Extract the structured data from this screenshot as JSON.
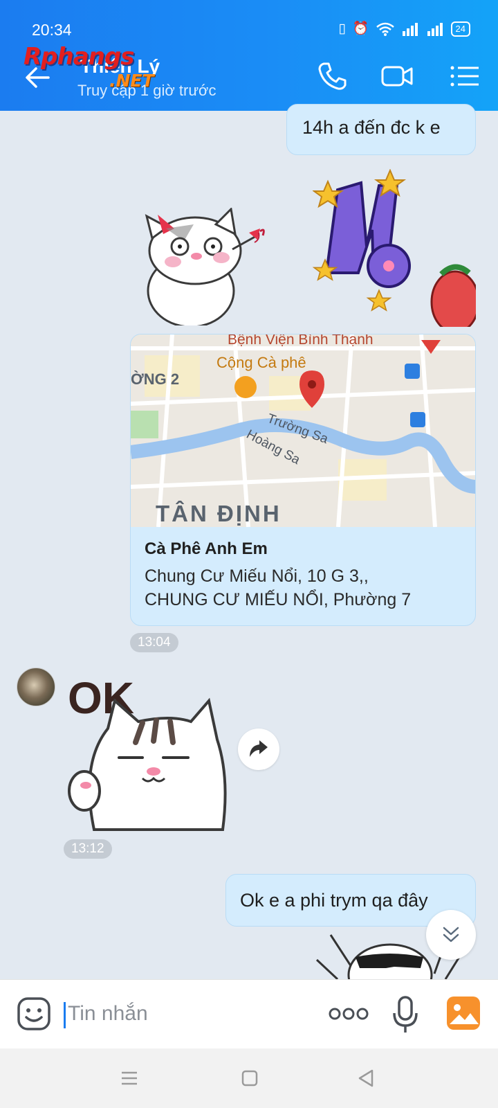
{
  "status_bar": {
    "time": "20:34",
    "battery": "24",
    "icons": [
      "vibrate-icon",
      "alarm-icon",
      "wifi-icon",
      "signal-icon",
      "signal-icon"
    ]
  },
  "header": {
    "contact_name": "Thiên Lý",
    "presence": "Truy cập 1 giờ trước",
    "watermark_main": "Rphangs",
    "watermark_suffix": ".NET",
    "actions": [
      "phone-icon",
      "video-call-icon",
      "menu-list-icon"
    ]
  },
  "messages": {
    "m1_text": "14h a đến đc k e",
    "location": {
      "map_labels": {
        "hospital": "Bệnh Viện Bình Thạnh",
        "cafe": "Cộng Cà phê",
        "ward": "ỜNG 2",
        "street1": "Trường Sa",
        "street2": "Hoàng Sa",
        "district": "TÂN ĐỊNH"
      },
      "place_name": "Cà Phê Anh Em",
      "address_line1": "Chung Cư Miếu Nổi, 10 G 3,,",
      "address_line2": "CHUNG CƯ MIẾU NỔI, Phường 7",
      "time": "13:04"
    },
    "ok_sticker_text": "OK",
    "ok_time": "13:12",
    "m2_text": "Ok e a phi trym qa đây"
  },
  "composer": {
    "placeholder": "Tin nhắn"
  },
  "colors": {
    "header_start": "#1b7cf0",
    "header_end": "#14a3f8",
    "bubble": "#d4ecfd",
    "chat_bg": "#e2e9f1"
  }
}
